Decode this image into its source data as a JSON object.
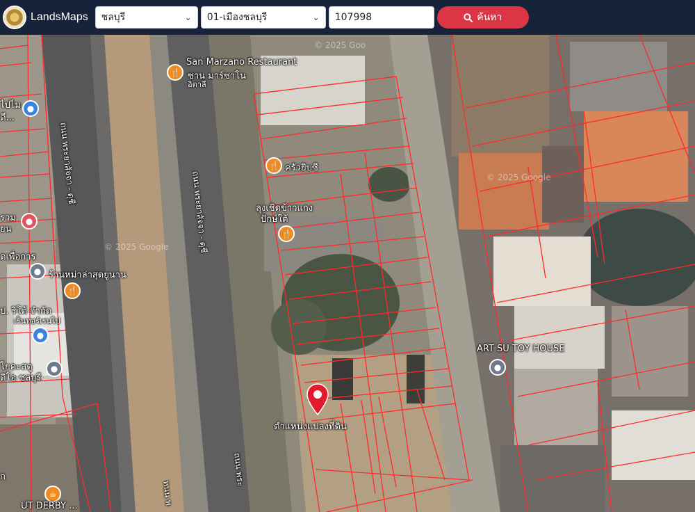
{
  "header": {
    "brand": "LandsMaps",
    "province": "ชลบุรี",
    "district": "01-เมืองชลบุรี",
    "parcel_number": "107998",
    "search_label": "ค้นหา"
  },
  "map": {
    "watermarks": [
      "© 2025 Goo",
      "© 2025 Google",
      "© 2025 Google"
    ],
    "road_labels": [
      "ถนน พระยาสัจจา - ดุชี",
      "ถนน พระยาสัจจา - ดุชี",
      "ถนน พระ",
      "หนน พ"
    ],
    "places": [
      {
        "text": "San Marzano Restaurant",
        "type": "food"
      },
      {
        "text": "ซาน มาร์ซาโน",
        "type": "food"
      },
      {
        "text": "อิตาลี",
        "type": "food"
      },
      {
        "text": "ครัวยิบซี",
        "type": "food"
      },
      {
        "text": "ลุงเชิดข้าวแกง",
        "type": "food"
      },
      {
        "text": "ปักษ์ใต้",
        "type": "food"
      },
      {
        "text": "ร้านหม่าล่าสุดยูนาน",
        "type": "food"
      },
      {
        "text": "ART SU TOY HOUSE",
        "type": "gray"
      }
    ],
    "left_edge_labels": [
      "ไปไม",
      "ตี...",
      "รวม",
      "ยน",
      "ดเพื่อการ",
      "ป. ริโต้ จำกัด",
      "เร็นทอร์เรนไป",
      "โยคะสตู",
      "ดิโอ ชลบุรี",
      "ก",
      "UT DERBY ..."
    ],
    "marker_label": "ตำแหน่งแปลงที่ดิน"
  }
}
